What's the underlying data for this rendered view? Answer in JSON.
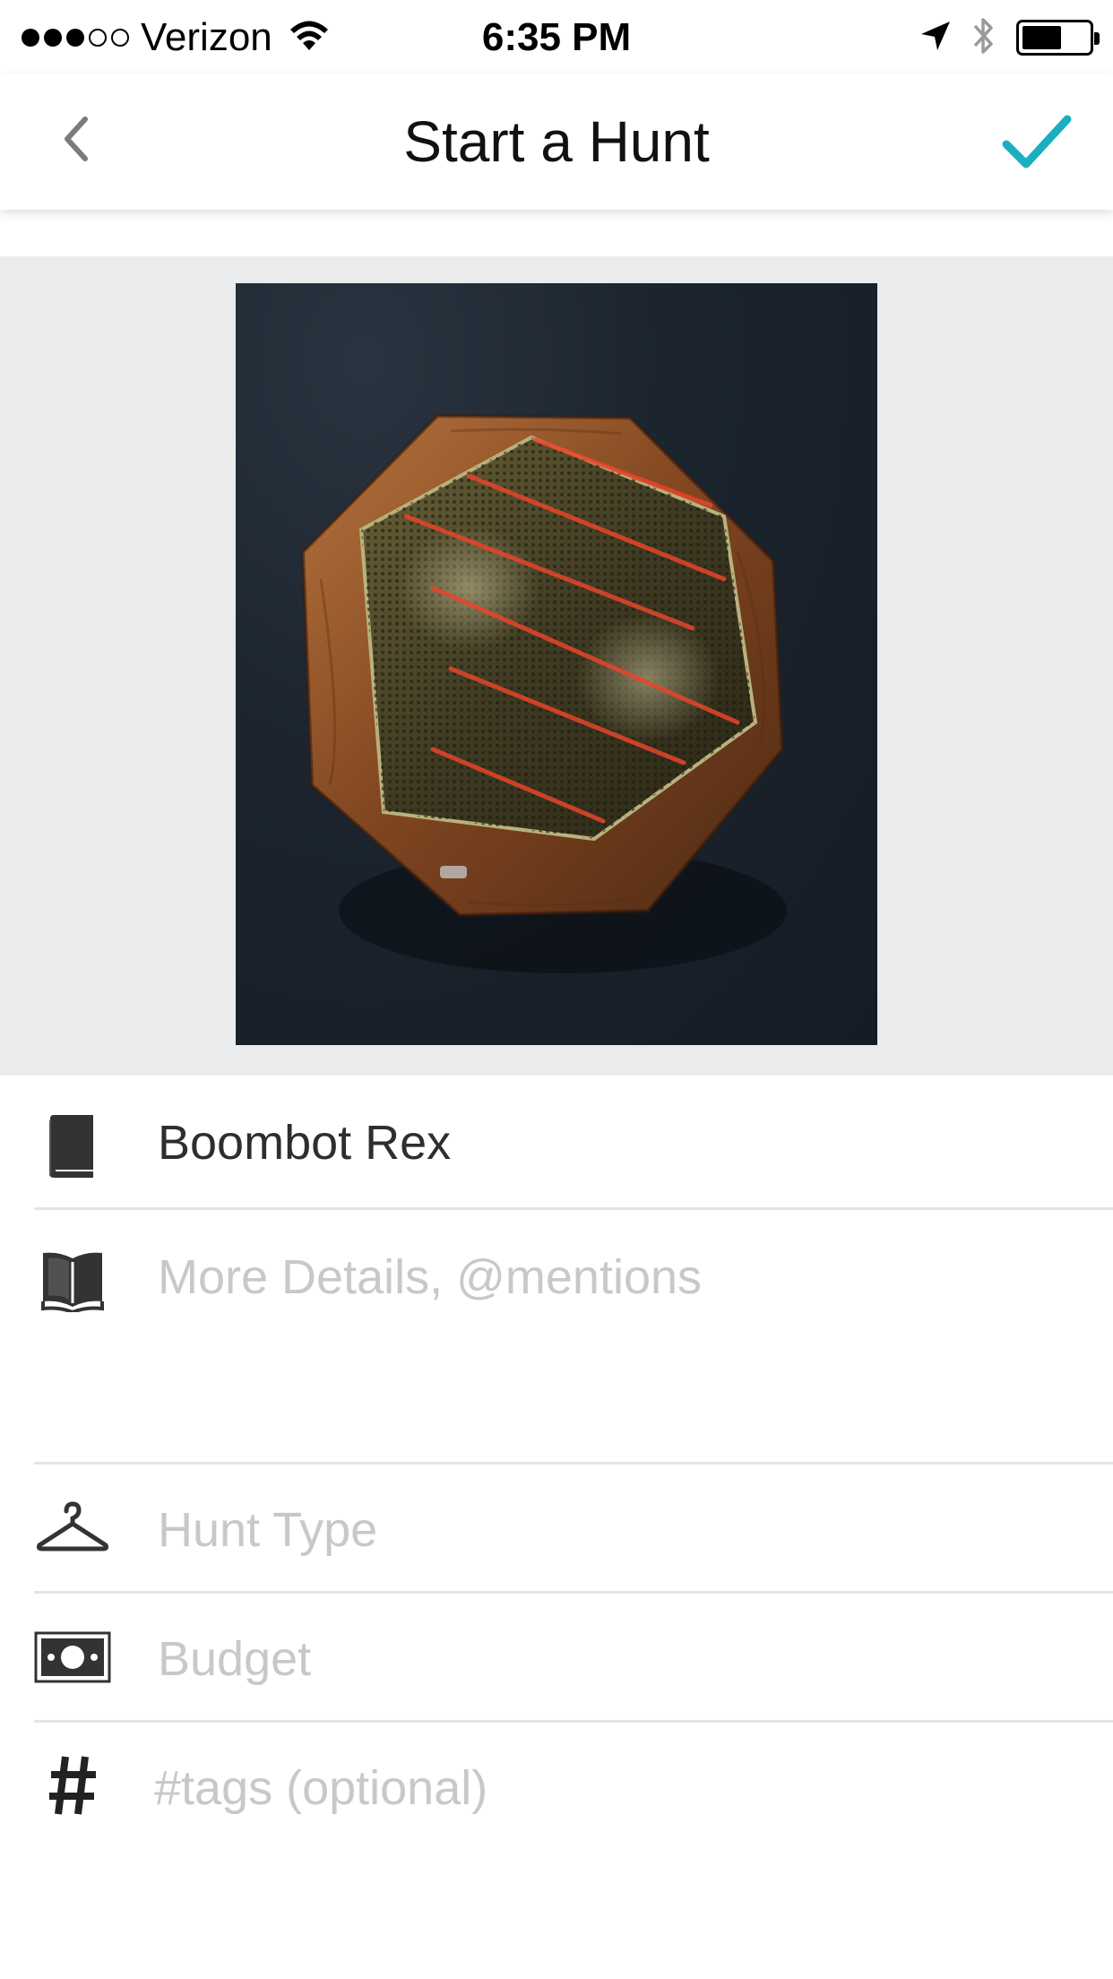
{
  "status_bar": {
    "carrier": "Verizon",
    "time": "6:35 PM",
    "signal_full": 3,
    "signal_empty": 2,
    "battery_level": 0.6
  },
  "nav": {
    "title": "Start a Hunt",
    "back_icon": "chevron-left-icon",
    "confirm_icon": "checkmark-icon"
  },
  "photo": {
    "description_icon": "product-photo"
  },
  "form": {
    "name": {
      "value": "Boombot Rex",
      "icon": "book-closed-icon"
    },
    "details": {
      "placeholder": "More Details, @mentions",
      "icon": "book-open-icon"
    },
    "hunt_type": {
      "placeholder": "Hunt Type",
      "icon": "hanger-icon"
    },
    "budget": {
      "placeholder": "Budget",
      "icon": "money-icon"
    },
    "tags": {
      "placeholder": "#tags (optional)",
      "icon": "hashtag-icon"
    }
  },
  "colors": {
    "accent": "#1aafbf",
    "nav_icon_gray": "#7b7b7b",
    "placeholder": "#c8c8cc",
    "text": "#2e2e2e",
    "photo_bg": "#eaebed"
  }
}
